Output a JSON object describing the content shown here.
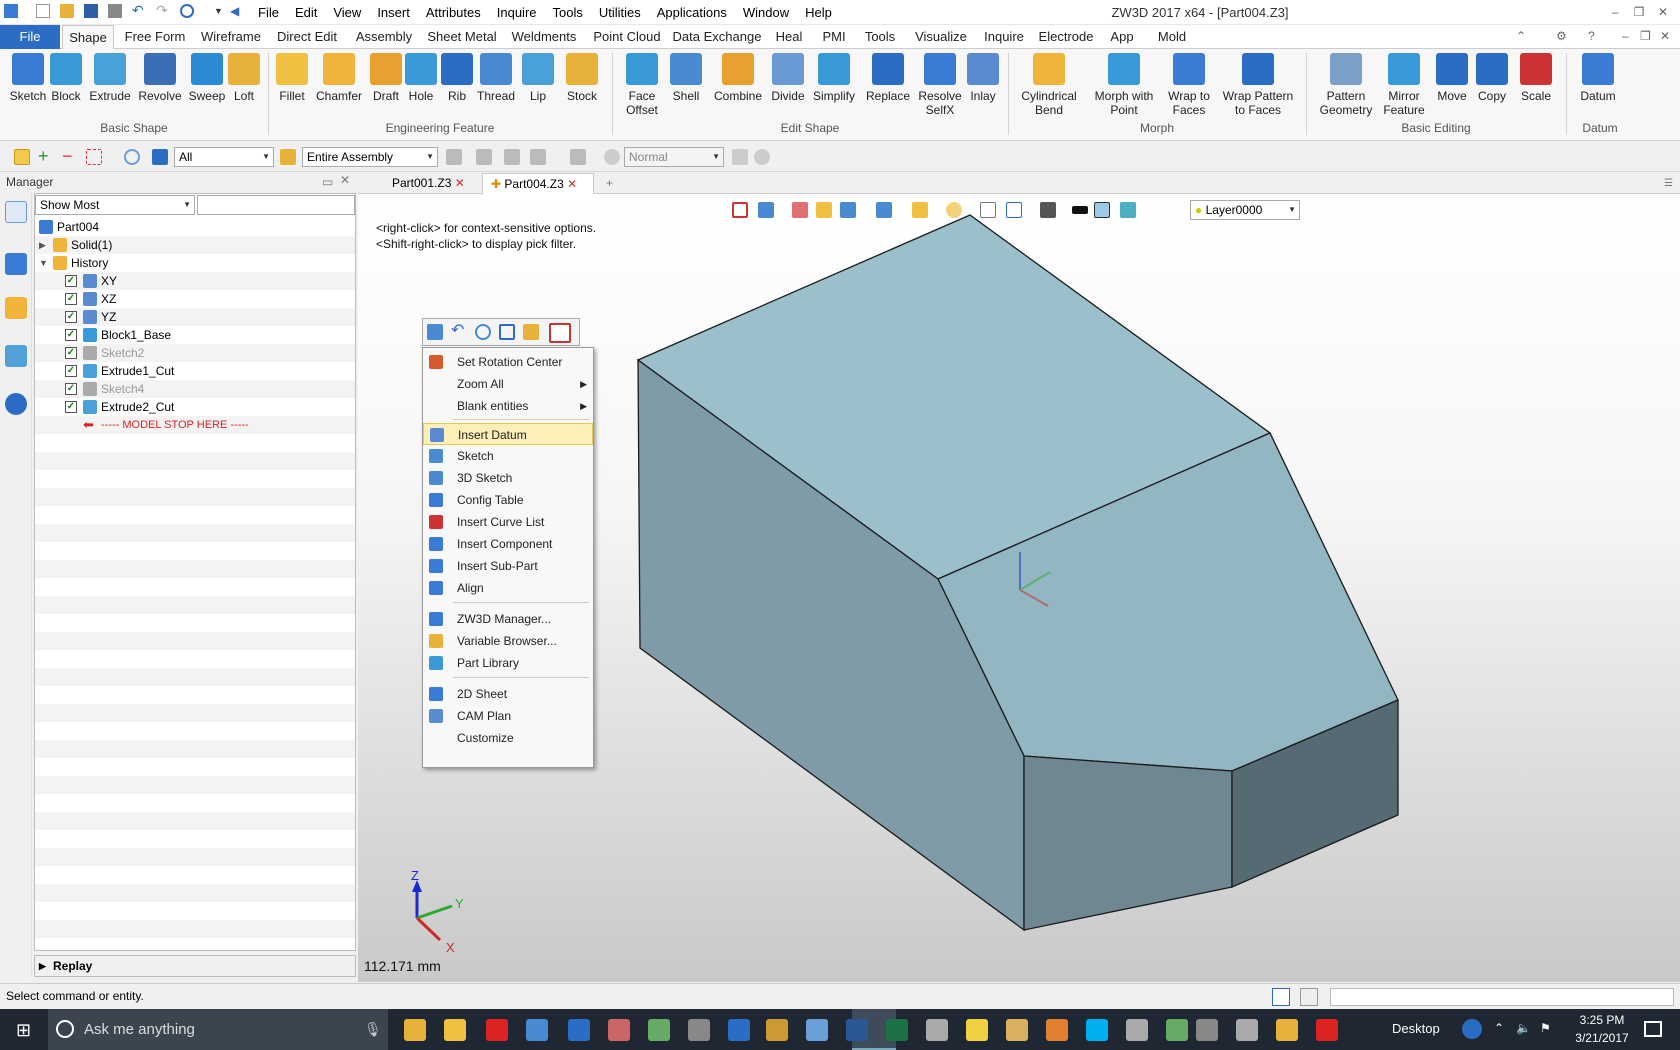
{
  "app": {
    "title": "ZW3D 2017  x64 - [Part004.Z3]",
    "menu": [
      "File",
      "Edit",
      "View",
      "Insert",
      "Attributes",
      "Inquire",
      "Tools",
      "Utilities",
      "Applications",
      "Window",
      "Help"
    ]
  },
  "ribbon_tabs": [
    "File",
    "Shape",
    "Free Form",
    "Wireframe",
    "Direct Edit",
    "Assembly",
    "Sheet Metal",
    "Weldments",
    "Point Cloud",
    "Data Exchange",
    "Heal",
    "PMI",
    "Tools",
    "Visualize",
    "Inquire",
    "Electrode",
    "App",
    "Mold"
  ],
  "ribbon": {
    "buttons": [
      {
        "l1": "Sketch",
        "l2": ""
      },
      {
        "l1": "Block",
        "l2": ""
      },
      {
        "l1": "Extrude",
        "l2": ""
      },
      {
        "l1": "Revolve",
        "l2": ""
      },
      {
        "l1": "Sweep",
        "l2": ""
      },
      {
        "l1": "Loft",
        "l2": ""
      },
      {
        "l1": "Fillet",
        "l2": ""
      },
      {
        "l1": "Chamfer",
        "l2": ""
      },
      {
        "l1": "Draft",
        "l2": ""
      },
      {
        "l1": "Hole",
        "l2": ""
      },
      {
        "l1": "Rib",
        "l2": ""
      },
      {
        "l1": "Thread",
        "l2": ""
      },
      {
        "l1": "Lip",
        "l2": ""
      },
      {
        "l1": "Stock",
        "l2": ""
      },
      {
        "l1": "Face",
        "l2": "Offset"
      },
      {
        "l1": "Shell",
        "l2": ""
      },
      {
        "l1": "Combine",
        "l2": ""
      },
      {
        "l1": "Divide",
        "l2": ""
      },
      {
        "l1": "Simplify",
        "l2": ""
      },
      {
        "l1": "Replace",
        "l2": ""
      },
      {
        "l1": "Resolve",
        "l2": "SelfX"
      },
      {
        "l1": "Inlay",
        "l2": ""
      },
      {
        "l1": "Cylindrical",
        "l2": "Bend"
      },
      {
        "l1": "Morph with",
        "l2": "Point"
      },
      {
        "l1": "Wrap to",
        "l2": "Faces"
      },
      {
        "l1": "Wrap Pattern",
        "l2": "to Faces"
      },
      {
        "l1": "Pattern",
        "l2": "Geometry"
      },
      {
        "l1": "Mirror",
        "l2": "Feature"
      },
      {
        "l1": "Move",
        "l2": ""
      },
      {
        "l1": "Copy",
        "l2": ""
      },
      {
        "l1": "Scale",
        "l2": ""
      },
      {
        "l1": "Datum",
        "l2": ""
      }
    ],
    "groups": [
      "Basic Shape",
      "Engineering Feature",
      "Edit Shape",
      "Morph",
      "Basic Editing",
      "Datum"
    ]
  },
  "toolbar": {
    "filter": "All",
    "scope": "Entire Assembly",
    "mode": "Normal"
  },
  "manager": {
    "title": "Manager",
    "show": "Show Most",
    "tree": [
      {
        "label": "Part004",
        "level": 0,
        "check": false
      },
      {
        "label": "Solid(1)",
        "level": 1,
        "check": false
      },
      {
        "label": "History",
        "level": 1,
        "check": false
      },
      {
        "label": "XY",
        "level": 2,
        "check": true
      },
      {
        "label": "XZ",
        "level": 2,
        "check": true
      },
      {
        "label": "YZ",
        "level": 2,
        "check": true
      },
      {
        "label": "Block1_Base",
        "level": 2,
        "check": true
      },
      {
        "label": "Sketch2",
        "level": 2,
        "check": true
      },
      {
        "label": "Extrude1_Cut",
        "level": 2,
        "check": true
      },
      {
        "label": "Sketch4",
        "level": 2,
        "check": true
      },
      {
        "label": "Extrude2_Cut",
        "level": 2,
        "check": true
      },
      {
        "label": "----- MODEL STOP HERE -----",
        "level": 2,
        "check": false
      }
    ],
    "replay": "Replay"
  },
  "doc_tabs": [
    "Part001.Z3",
    "Part004.Z3"
  ],
  "viewport": {
    "hint1": "<right-click> for context-sensitive options.",
    "hint2": "<Shift-right-click> to display pick filter.",
    "layer": "Layer0000",
    "dimension": "112.171 mm",
    "axes": {
      "x": "X",
      "y": "Y",
      "z": "Z"
    }
  },
  "context_menu": [
    {
      "label": "Set Rotation Center",
      "sub": false
    },
    {
      "label": "Zoom All",
      "sub": true
    },
    {
      "label": "Blank entities",
      "sub": true
    },
    {
      "label": "Insert Datum",
      "sub": false
    },
    {
      "label": "Sketch",
      "sub": false
    },
    {
      "label": "3D Sketch",
      "sub": false
    },
    {
      "label": "Config Table",
      "sub": false
    },
    {
      "label": "Insert Curve List",
      "sub": false
    },
    {
      "label": "Insert Component",
      "sub": false
    },
    {
      "label": "Insert Sub-Part",
      "sub": false
    },
    {
      "label": "Align",
      "sub": false
    },
    {
      "label": "ZW3D Manager...",
      "sub": false
    },
    {
      "label": "Variable Browser...",
      "sub": false
    },
    {
      "label": "Part Library",
      "sub": false
    },
    {
      "label": "2D Sheet",
      "sub": false
    },
    {
      "label": "CAM Plan",
      "sub": false
    },
    {
      "label": "Customize",
      "sub": false
    }
  ],
  "status": {
    "text": "Select command or entity."
  },
  "taskbar": {
    "search": "Ask me anything",
    "desktop": "Desktop",
    "time": "3:25 PM",
    "date": "3/21/2017"
  }
}
